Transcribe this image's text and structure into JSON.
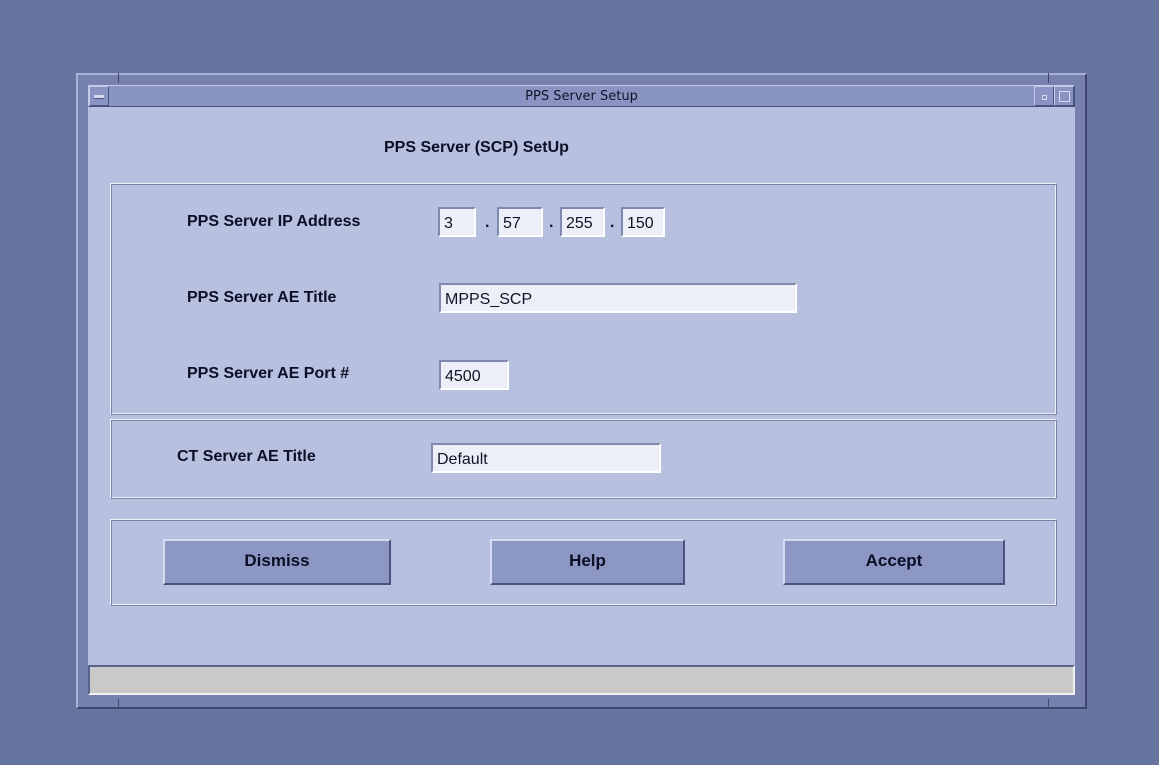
{
  "window": {
    "title": "PPS Server Setup"
  },
  "dialog": {
    "heading": "PPS Server (SCP) SetUp"
  },
  "server": {
    "ip_label": "PPS Server IP Address",
    "ip_octets": [
      "3",
      "57",
      "255",
      "150"
    ],
    "ip_separator": ".",
    "ae_title_label": "PPS Server AE Title",
    "ae_title_value": "MPPS_SCP",
    "ae_port_label": "PPS Server AE Port #",
    "ae_port_value": "4500"
  },
  "ct": {
    "ae_title_label": "CT Server AE Title",
    "ae_title_value": "Default"
  },
  "buttons": {
    "dismiss": "Dismiss",
    "help": "Help",
    "accept": "Accept"
  },
  "status": {
    "text": ""
  },
  "colors": {
    "desktop": "#6874a0",
    "panel": "#b8c0df",
    "button": "#8d97c4",
    "statusbar": "#c9c9c9"
  }
}
